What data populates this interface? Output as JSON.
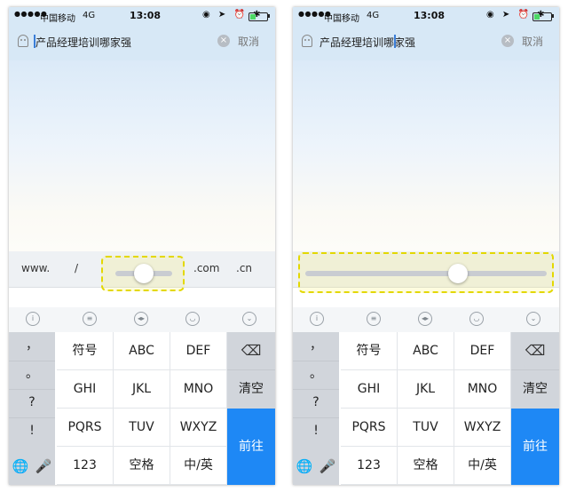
{
  "colors": {
    "accent": "#1e88f5",
    "highlight": "#e3d800",
    "header_bg": "#d7e8f6"
  },
  "screens": [
    {
      "status": {
        "signal": "●●●●●",
        "carrier": "中国移动",
        "network": "4G",
        "time": "13:08",
        "icons": "◉ ➤ ⏰ ✱"
      },
      "search": {
        "query": "产品经理培训哪家强",
        "clear_icon": "×",
        "cancel": "取消"
      },
      "urlbar": {
        "keys": [
          "www.",
          "/",
          ".com",
          ".cn"
        ],
        "cursor_slider": "collapsed"
      },
      "toolbar_icons": [
        "ifly-icon",
        "chat-icon",
        "cursor-move-icon",
        "emoji-icon",
        "collapse-icon"
      ],
      "keyboard": {
        "punctuation": [
          "，",
          "。",
          "?",
          "!"
        ],
        "rows": [
          [
            "符号",
            "ABC",
            "DEF"
          ],
          [
            "GHI",
            "JKL",
            "MNO"
          ],
          [
            "PQRS",
            "TUV",
            "WXYZ"
          ],
          [
            "123",
            "空格",
            "中/英"
          ]
        ],
        "delete": "⌫",
        "clear": "清空",
        "go": "前往",
        "globe": "🌐",
        "mic": "🎤"
      }
    },
    {
      "status": {
        "signal": "●●●●●",
        "carrier": "中国移动",
        "network": "4G",
        "time": "13:08",
        "icons": "◉ ➤ ⏰ ✱"
      },
      "search": {
        "query": "产品经理培训哪家强",
        "clear_icon": "×",
        "cancel": "取消"
      },
      "urlbar": {
        "cursor_slider": "expanded"
      },
      "toolbar_icons": [
        "ifly-icon",
        "chat-icon",
        "cursor-move-icon",
        "emoji-icon",
        "collapse-icon"
      ],
      "keyboard": {
        "punctuation": [
          "，",
          "。",
          "?",
          "!"
        ],
        "rows": [
          [
            "符号",
            "ABC",
            "DEF"
          ],
          [
            "GHI",
            "JKL",
            "MNO"
          ],
          [
            "PQRS",
            "TUV",
            "WXYZ"
          ],
          [
            "123",
            "空格",
            "中/英"
          ]
        ],
        "delete": "⌫",
        "clear": "清空",
        "go": "前往",
        "globe": "🌐",
        "mic": "🎤"
      }
    }
  ]
}
